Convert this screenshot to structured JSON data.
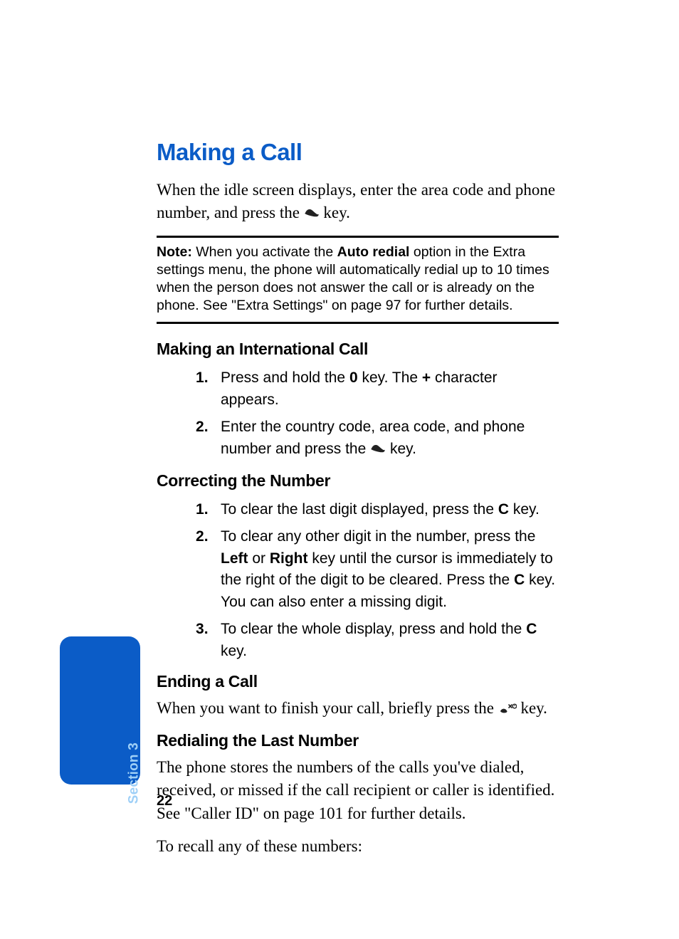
{
  "page_number": "22",
  "section_tab": "Section 3",
  "title": "Making a Call",
  "intro_before_icon": "When the idle screen displays, enter the area code and phone number, and press the ",
  "intro_after_icon": " key.",
  "note": {
    "label": "Note:",
    "before_bold": " When you activate the ",
    "bold": "Auto redial",
    "after_bold": " option in the Extra settings menu, the phone will automatically redial up to 10 times when the person does not answer the call or is already on the phone. See \"Extra Settings\" on page 97 for further details."
  },
  "intl": {
    "heading": "Making an International Call",
    "step1": {
      "a": "Press and hold the ",
      "b1": "0",
      "c": " key. The ",
      "b2": "+",
      "d": " character appears."
    },
    "step2": {
      "a": "Enter the country code, area code, and phone number and press the ",
      "b": " key."
    }
  },
  "correct": {
    "heading": "Correcting the Number",
    "step1": {
      "a": "To clear the last digit displayed, press the ",
      "b1": "C",
      "c": " key."
    },
    "step2": {
      "a": "To clear any other digit in the number, press the ",
      "b1": "Left",
      "c": " or ",
      "b2": "Right",
      "d": " key until the cursor is immediately to the right of the digit to be cleared. Press the ",
      "b3": "C",
      "e": " key. You can also enter a missing digit."
    },
    "step3": {
      "a": "To clear the whole display, press and hold the ",
      "b1": "C",
      "c": " key."
    }
  },
  "ending": {
    "heading": "Ending a Call",
    "body_before": "When you want to finish your call, briefly press the ",
    "body_after": " key."
  },
  "redial": {
    "heading": "Redialing the Last Number",
    "p1": "The phone stores the numbers of the calls you've dialed, received, or missed if the call recipient or caller is identified. See \"Caller ID\" on page 101 for further details.",
    "p2": "To recall any of these numbers:"
  },
  "icons": {
    "call_key": "phone-handset-icon",
    "end_key": "end-call-icon"
  }
}
